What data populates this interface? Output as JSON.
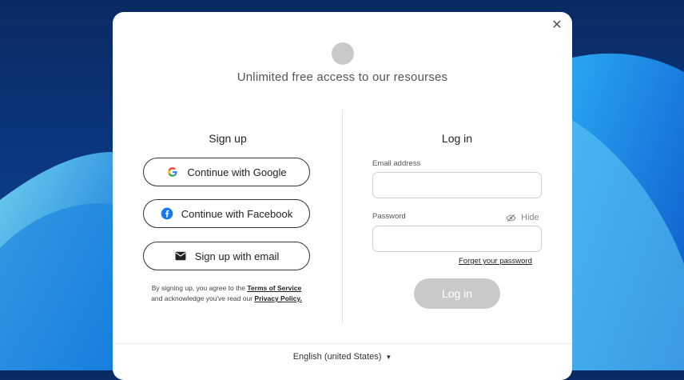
{
  "modal": {
    "headline": "Unlimited free access to our resourses",
    "close_icon": "close-icon"
  },
  "signup": {
    "title": "Sign up",
    "google_label": "Continue with Google",
    "facebook_label": "Continue with Facebook",
    "email_label": "Sign up with email",
    "terms_prefix": "By signing up, you agree to the",
    "terms_link": "Terms of Service",
    "terms_middle": "and acknowledge you've read our",
    "privacy_link": "Privacy Policy."
  },
  "login": {
    "title": "Log in",
    "email_label": "Email address",
    "email_value": "",
    "password_label": "Password",
    "password_value": "",
    "hide_label": "Hide",
    "forgot_label": "Forget your password",
    "submit_label": "Log in"
  },
  "footer": {
    "language": "English (united States)"
  },
  "colors": {
    "background": "#0b3b86",
    "button_disabled": "#c9c9c9",
    "google_blue": "#4285F4",
    "facebook_blue": "#1877F2"
  }
}
